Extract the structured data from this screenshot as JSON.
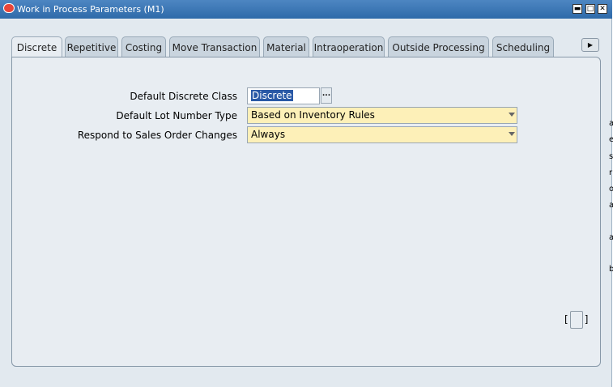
{
  "window": {
    "title": "Work in Process Parameters (M1)",
    "controls": {
      "minimize": "▬",
      "maximize": "□",
      "close": "✕"
    }
  },
  "side_text": [
    "a",
    "e",
    "s",
    "r",
    "o",
    "a",
    "a",
    "b"
  ],
  "tabs": [
    {
      "label": "Discrete",
      "active": true
    },
    {
      "label": "Repetitive",
      "active": false
    },
    {
      "label": "Costing",
      "active": false
    },
    {
      "label": "Move Transaction",
      "active": false
    },
    {
      "label": "Material",
      "active": false
    },
    {
      "label": "Intraoperation",
      "active": false
    },
    {
      "label": "Outside Processing",
      "active": false
    },
    {
      "label": "Scheduling",
      "active": false
    }
  ],
  "tab_scroll_icon": "right-arrow-icon",
  "form": {
    "default_class_label": "Default Discrete Class",
    "default_class_value": "Discrete",
    "lov_button": "...",
    "lot_number_label": "Default Lot Number Type",
    "lot_number_value": "Based on Inventory Rules",
    "sales_order_label": "Respond to Sales Order Changes",
    "sales_order_value": "Always"
  },
  "frame_indicator": {
    "left": "[",
    "right": "]"
  },
  "colors": {
    "titlebar": "#2e6aa9",
    "required_field": "#fdf0b8",
    "panel": "#e8edf2",
    "selection": "#2a59a6"
  }
}
